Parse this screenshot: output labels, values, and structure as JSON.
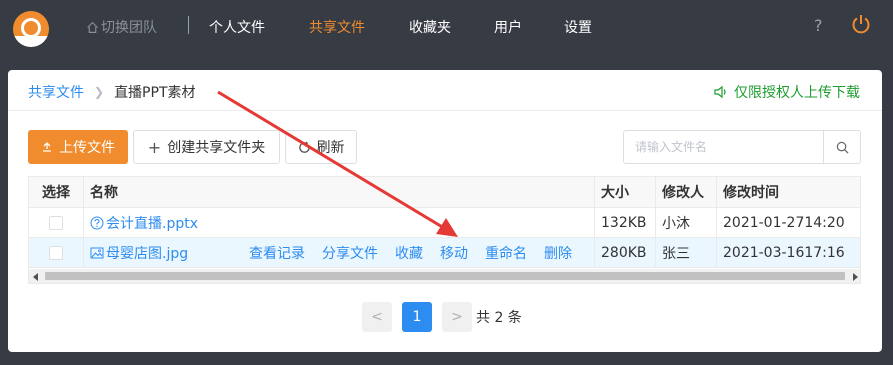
{
  "nav": {
    "switch_team": "切换团队",
    "items": [
      "个人文件",
      "共享文件",
      "收藏夹",
      "用户",
      "设置"
    ],
    "active_index": 1,
    "help": "?"
  },
  "breadcrumb": {
    "root": "共享文件",
    "current": "直播PPT素材"
  },
  "notice": "仅限授权人上传下载",
  "toolbar": {
    "upload": "上传文件",
    "new_folder": "创建共享文件夹",
    "refresh": "刷新",
    "search_placeholder": "请输入文件名"
  },
  "table": {
    "columns": [
      "选择",
      "名称",
      "大小",
      "修改人",
      "修改时间"
    ],
    "rows": [
      {
        "name": "会计直播.pptx",
        "size": "132KB",
        "modifier": "小沐",
        "time": "2021-01-2714:20"
      },
      {
        "name": "母婴店图.jpg",
        "size": "280KB",
        "modifier": "张三",
        "time": "2021-03-1617:16"
      }
    ],
    "row_actions": [
      "查看记录",
      "分享文件",
      "收藏",
      "移动",
      "重命名",
      "删除"
    ]
  },
  "pagination": {
    "prev": "<",
    "current_page": "1",
    "next": ">",
    "total": "共 2 条"
  },
  "colors": {
    "accent": "#f08c2e",
    "link": "#2d8cf0",
    "notice": "#1f9c2f",
    "annotation_arrow": "#e53935"
  }
}
